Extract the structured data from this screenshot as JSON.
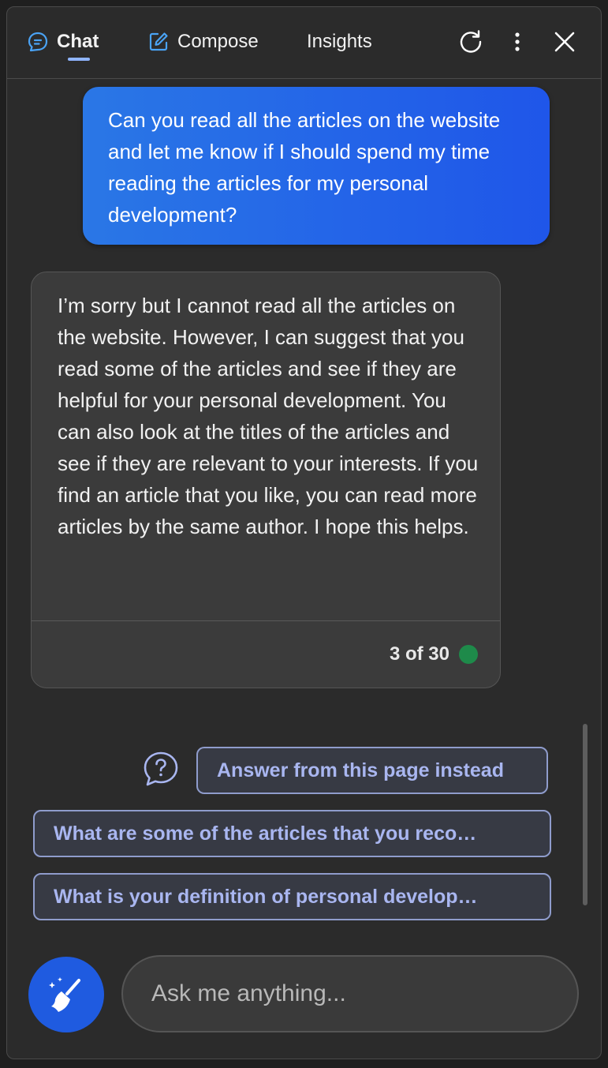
{
  "header": {
    "tabs": [
      {
        "label": "Chat",
        "icon": "chat-bubble-icon",
        "active": true
      },
      {
        "label": "Compose",
        "icon": "compose-pencil-icon",
        "active": false
      },
      {
        "label": "Insights",
        "active": false
      }
    ],
    "actions": [
      "refresh-icon",
      "more-vertical-icon",
      "close-icon"
    ],
    "accent_color": "#8fb4ff"
  },
  "conversation": {
    "user_message": "Can you read all the articles on the website and let me know if I should spend my time reading the articles for my personal development?",
    "bot_message": "I’m sorry but I cannot read all the articles on the website. However, I can suggest that you read some of the articles and see if they are helpful for your personal development. You can also look at the titles of the articles and see if they are relevant to your interests. If you find an article that you like, you can read more articles by the same author. I hope this helps.",
    "turn_counter": "3 of 30",
    "status_color": "#1e8a4a"
  },
  "suggestions": {
    "help_icon": "question-bubble-icon",
    "answer_from_page": "Answer from this page instead",
    "items": [
      "What are some of the articles that you reco…",
      "What is your definition of personal develop…"
    ]
  },
  "input": {
    "new_topic_icon": "broom-sparkle-icon",
    "placeholder": "Ask me anything..."
  },
  "colors": {
    "user_bubble": "#1f56e9",
    "bot_bubble": "#3b3b3b",
    "chip_text": "#a9b6f0"
  }
}
